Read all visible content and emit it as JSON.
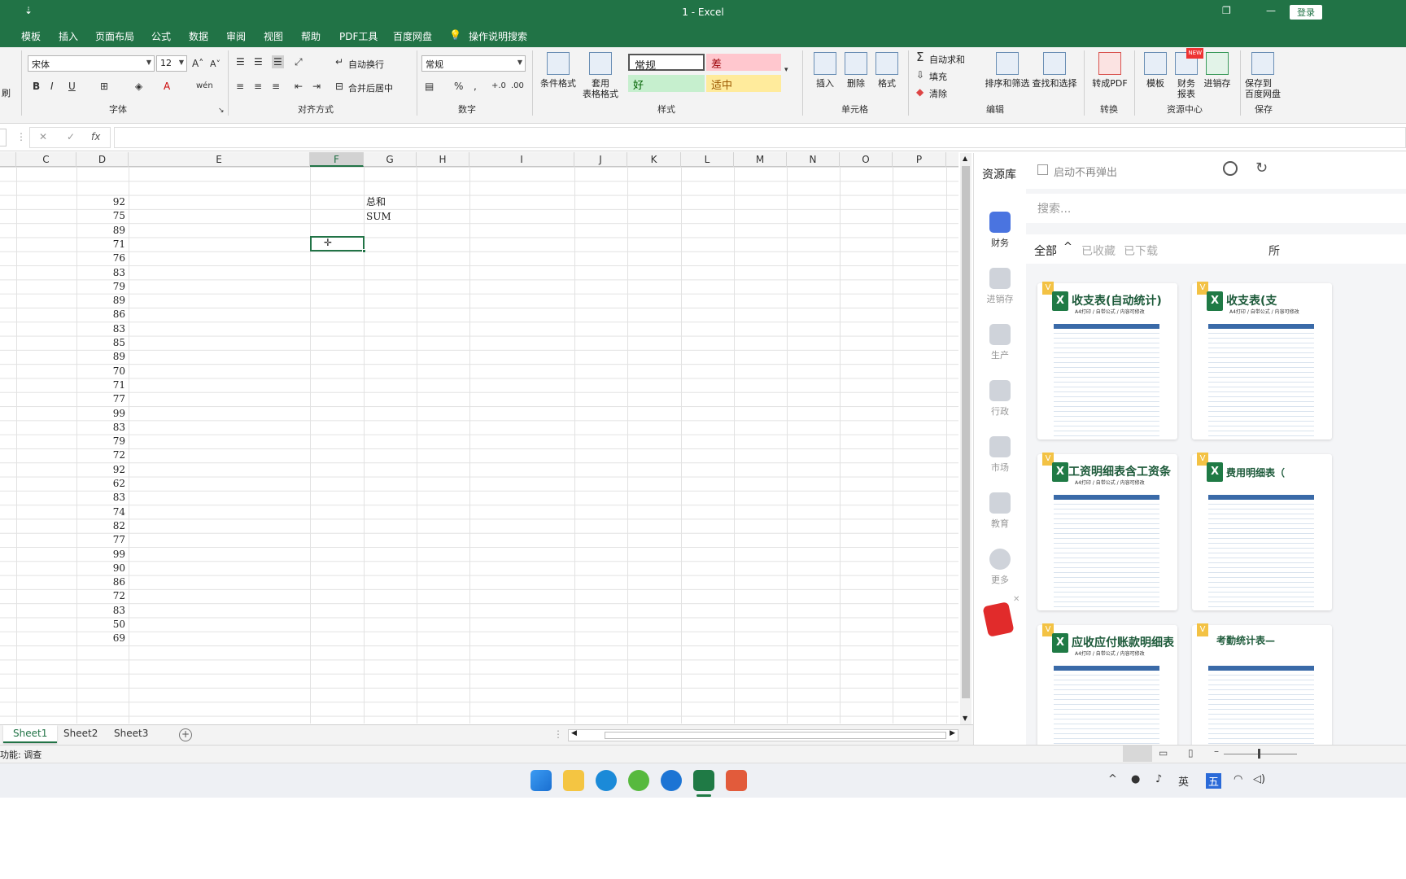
{
  "window": {
    "title": "1  -  Excel",
    "login": "登录",
    "qa_more": "⇣",
    "restore": "❐"
  },
  "menu": [
    "模板",
    "插入",
    "页面布局",
    "公式",
    "数据",
    "审阅",
    "视图",
    "帮助",
    "PDF工具",
    "百度网盘"
  ],
  "menu_search": "操作说明搜索",
  "ribbon": {
    "font_name": "宋体",
    "font_size": "12",
    "number_format": "常规",
    "wrap": "自动换行",
    "merge": "合并后居中",
    "cond_format": "条件格式",
    "table_format_1": "套用",
    "table_format_2": "表格格式",
    "styles": {
      "normal": "常规",
      "bad": "差",
      "good": "好",
      "neutral": "适中"
    },
    "insert": "插入",
    "delete": "删除",
    "format": "格式",
    "autosum": "自动求和",
    "fill": "填充",
    "clear": "清除",
    "sort_filter": "排序和筛选",
    "find_select": "查找和选择",
    "to_pdf": "转成PDF",
    "template": "模板",
    "finance_1": "财务",
    "finance_2": "报表",
    "inventory": "进销存",
    "save_cloud_1": "保存到",
    "save_cloud_2": "百度网盘",
    "new_badge": "NEW",
    "groups": {
      "font": "字体",
      "align": "对齐方式",
      "number": "数字",
      "styles": "样式",
      "cells": "单元格",
      "edit": "编辑",
      "convert": "转换",
      "resource": "资源中心",
      "save": "保存"
    },
    "clipboard_fragment": "刷",
    "percent": "%",
    "comma": ",",
    "dec_inc": "+.0",
    "dec_dec": ".00"
  },
  "formula_bar": {
    "cancel": "✕",
    "confirm": "✓",
    "fx": "fx",
    "content": ""
  },
  "columns": [
    "C",
    "D",
    "E",
    "F",
    "G",
    "H",
    "I",
    "J",
    "K",
    "L",
    "M",
    "N",
    "O",
    "P"
  ],
  "column_d_values": [
    "92",
    "75",
    "89",
    "71",
    "76",
    "83",
    "79",
    "89",
    "86",
    "83",
    "85",
    "89",
    "70",
    "71",
    "77",
    "99",
    "83",
    "79",
    "72",
    "92",
    "62",
    "83",
    "74",
    "82",
    "77",
    "99",
    "90",
    "86",
    "72",
    "83",
    "50",
    "69"
  ],
  "g_labels": [
    "总和",
    "SUM"
  ],
  "sheets": [
    "Sheet1",
    "Sheet2",
    "Sheet3"
  ],
  "add_sheet": "+",
  "status_left": "功能: 调查",
  "panel": {
    "title": "资源库",
    "no_popup": "启动不再弹出",
    "search_placeholder": "搜索...",
    "filters": [
      "全部",
      "已收藏",
      "已下载"
    ],
    "filter_more": "所",
    "side": [
      "财务",
      "进销存",
      "生产",
      "行政",
      "市场",
      "教育",
      "更多"
    ],
    "cards": [
      {
        "title": "收支表(自动统计)",
        "sub": "A4打印 / 自带公式 / 内容可修改"
      },
      {
        "title": "收支表(支",
        "sub": "A4打印 / 自带公式 / 内容可修改"
      },
      {
        "title": "工资明细表含工资条",
        "sub": "A4打印 / 自带公式 / 内容可修改"
      },
      {
        "title": "费用明细表（",
        "sub": ""
      },
      {
        "title": "应收应付账款明细表",
        "sub": "A4打印 / 自带公式 / 内容可修改"
      },
      {
        "title": "考勤统计表—",
        "sub": ""
      }
    ],
    "badge": "V"
  },
  "colors": {
    "excel_green": "#217346",
    "selected_accent": "#217346"
  }
}
